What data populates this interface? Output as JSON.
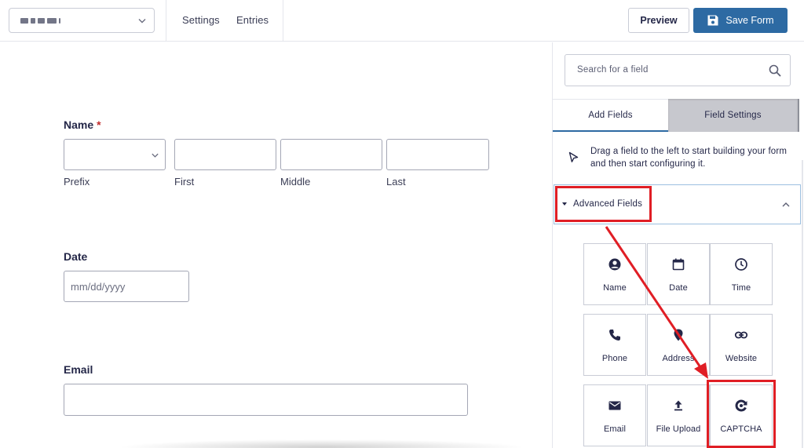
{
  "header": {
    "form_selector_value": "",
    "nav": {
      "settings": "Settings",
      "entries": "Entries"
    },
    "preview_label": "Preview",
    "save_label": "Save Form"
  },
  "form": {
    "name_field": {
      "label": "Name",
      "required_mark": "*",
      "sublabels": {
        "prefix": "Prefix",
        "first": "First",
        "middle": "Middle",
        "last": "Last"
      }
    },
    "date_field": {
      "label": "Date",
      "placeholder": "mm/dd/yyyy"
    },
    "email_field": {
      "label": "Email"
    }
  },
  "sidebar": {
    "search_placeholder": "Search for a field",
    "tabs": {
      "add_fields": "Add Fields",
      "field_settings": "Field Settings"
    },
    "hint": "Drag a field to the left to start building your form and then start configuring it.",
    "section_title": "Advanced Fields",
    "fields": [
      {
        "label": "Name",
        "icon": "user-circle-icon"
      },
      {
        "label": "Date",
        "icon": "calendar-icon"
      },
      {
        "label": "Time",
        "icon": "clock-icon"
      },
      {
        "label": "Phone",
        "icon": "phone-icon"
      },
      {
        "label": "Address",
        "icon": "map-pin-icon"
      },
      {
        "label": "Website",
        "icon": "link-icon"
      },
      {
        "label": "Email",
        "icon": "envelope-icon"
      },
      {
        "label": "File Upload",
        "icon": "upload-icon"
      },
      {
        "label": "CAPTCHA",
        "icon": "captcha-icon"
      }
    ]
  },
  "colors": {
    "primary": "#2d6aa3",
    "text": "#242748",
    "border": "#c9ccd6",
    "required": "#c02b2b",
    "annotation": "#e01e25"
  }
}
